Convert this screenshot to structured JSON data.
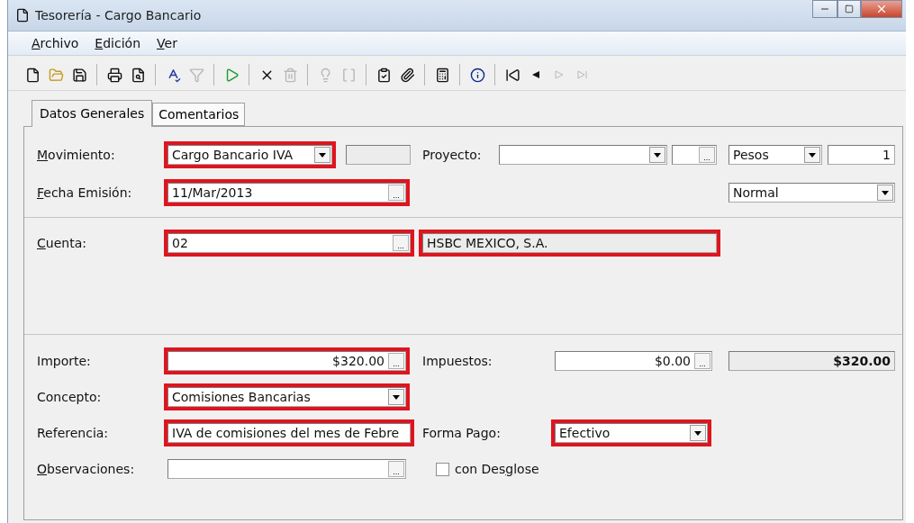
{
  "window": {
    "title": "Tesorería - Cargo Bancario"
  },
  "menu": [
    {
      "label": "Archivo"
    },
    {
      "label": "Edición"
    },
    {
      "label": "Ver"
    }
  ],
  "toolbar": [
    {
      "enabled": true
    },
    {
      "enabled": true
    },
    {
      "enabled": true
    },
    {
      "enabled": true
    },
    {
      "enabled": true
    },
    {
      "enabled": true
    },
    {
      "enabled": false
    },
    {
      "enabled": true
    },
    {
      "enabled": true
    },
    {
      "enabled": false
    },
    {
      "enabled": false
    },
    {
      "enabled": false
    },
    {
      "enabled": true
    },
    {
      "enabled": true
    },
    {
      "enabled": true
    },
    {
      "enabled": true
    },
    {
      "enabled": true
    },
    {
      "enabled": true
    },
    {
      "enabled": false
    },
    {
      "enabled": false
    }
  ],
  "tabs": [
    {
      "label": "Datos Generales",
      "selected": true
    },
    {
      "label": "Comentarios",
      "selected": false
    }
  ],
  "sections": [
    {
      "rows": [
        [
          {
            "kind": "label",
            "text": "Movimiento:"
          },
          {
            "kind": "combo",
            "value": "Cargo Bancario IVA",
            "highlighted": true
          },
          {
            "kind": "readonly"
          },
          {
            "kind": "label",
            "text": "Proyecto:"
          },
          {
            "kind": "combo"
          },
          {
            "kind": "text",
            "button": "..."
          },
          {
            "kind": "combo",
            "value": "Pesos"
          },
          {
            "kind": "text",
            "value": "1"
          }
        ],
        [
          {
            "kind": "label",
            "text": "Fecha Emisión:"
          },
          {
            "kind": "text",
            "value": "11/Mar/2013",
            "button": "...",
            "highlighted": true
          },
          {
            "kind": "combo",
            "value": "Normal"
          }
        ]
      ]
    },
    {
      "rows": [
        [
          {
            "kind": "label",
            "text": "Cuenta:"
          },
          {
            "kind": "text",
            "value": "02",
            "button": "...",
            "highlighted": true
          },
          {
            "kind": "readonly",
            "value": "HSBC MEXICO, S.A.",
            "highlighted": true
          }
        ]
      ]
    },
    {
      "rows": [
        [
          {
            "kind": "label",
            "text": "Importe:"
          },
          {
            "kind": "text",
            "value": "$320.00",
            "button": "...",
            "highlighted": true
          },
          {
            "kind": "label",
            "text": "Impuestos:"
          },
          {
            "kind": "text",
            "value": "$0.00",
            "button": "..."
          },
          {
            "kind": "readonly",
            "value": "$320.00",
            "bold": true
          }
        ],
        [
          {
            "kind": "label",
            "text": "Concepto:"
          },
          {
            "kind": "combo",
            "value": "Comisiones Bancarias",
            "highlighted": true
          }
        ],
        [
          {
            "kind": "label",
            "text": "Referencia:"
          },
          {
            "kind": "text",
            "value": "IVA de comisiones del mes de Febre",
            "highlighted": true
          },
          {
            "kind": "label",
            "text": "Forma Pago:"
          },
          {
            "kind": "combo",
            "value": "Efectivo",
            "highlighted": true
          }
        ],
        [
          {
            "kind": "label",
            "text": "Observaciones:"
          },
          {
            "kind": "text",
            "button": "..."
          },
          {
            "kind": "checkbox",
            "text": "con Desglose",
            "checked": false
          }
        ]
      ]
    }
  ]
}
